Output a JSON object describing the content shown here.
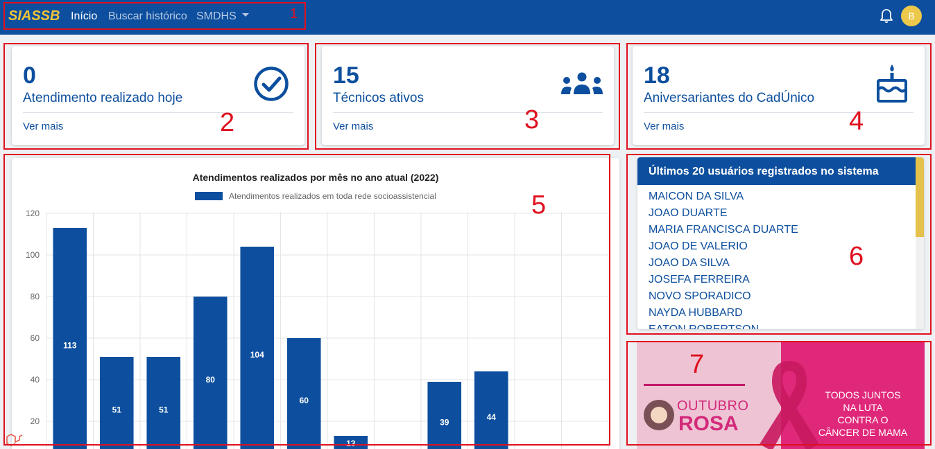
{
  "navbar": {
    "brand": "SIASSB",
    "links": [
      "Início",
      "Buscar histórico",
      "SMDHS"
    ],
    "avatar_initial": "B",
    "bg_color": "#0d4f9e",
    "brand_color": "#f2c335"
  },
  "stats": [
    {
      "value": "0",
      "label": "Atendimento realizado hoje",
      "link": "Ver mais",
      "icon": "check-circle-icon"
    },
    {
      "value": "15",
      "label": "Técnicos ativos",
      "link": "Ver mais",
      "icon": "users-icon"
    },
    {
      "value": "18",
      "label": "Aniversariantes do CadÚnico",
      "link": "Ver mais",
      "icon": "birthday-cake-icon"
    }
  ],
  "chart_data": {
    "type": "bar",
    "title": "Atendimentos realizados por mês no ano atual (2022)",
    "series": [
      {
        "name": "Atendimentos realizados em toda rede socioassistencial",
        "values": [
          113,
          51,
          51,
          80,
          104,
          60,
          13,
          null,
          39,
          44,
          null,
          null
        ],
        "color": "#0d4f9e"
      }
    ],
    "y_ticks": [
      20,
      40,
      60,
      80,
      100,
      120
    ],
    "ylim": [
      0,
      120
    ],
    "grid": true,
    "legend": "top"
  },
  "users": {
    "title": "Últimos 20 usuários registrados no sistema",
    "items": [
      "MAICON DA SILVA",
      "JOAO DUARTE",
      "MARIA FRANCISCA DUARTE",
      "JOAO DE VALERIO",
      "JOAO DA SILVA",
      "JOSEFA FERREIRA",
      "NOVO SPORADICO",
      "NAYDA HUBBARD",
      "EATON ROBERTSON"
    ]
  },
  "banner": {
    "outubro": "OUTUBRO",
    "rosa": "ROSA",
    "text_lines": [
      "TODOS JUNTOS",
      "NA LUTA",
      "CONTRA O",
      "CÂNCER DE MAMA"
    ]
  },
  "annotations": [
    "1",
    "2",
    "3",
    "4",
    "5",
    "6",
    "7"
  ]
}
